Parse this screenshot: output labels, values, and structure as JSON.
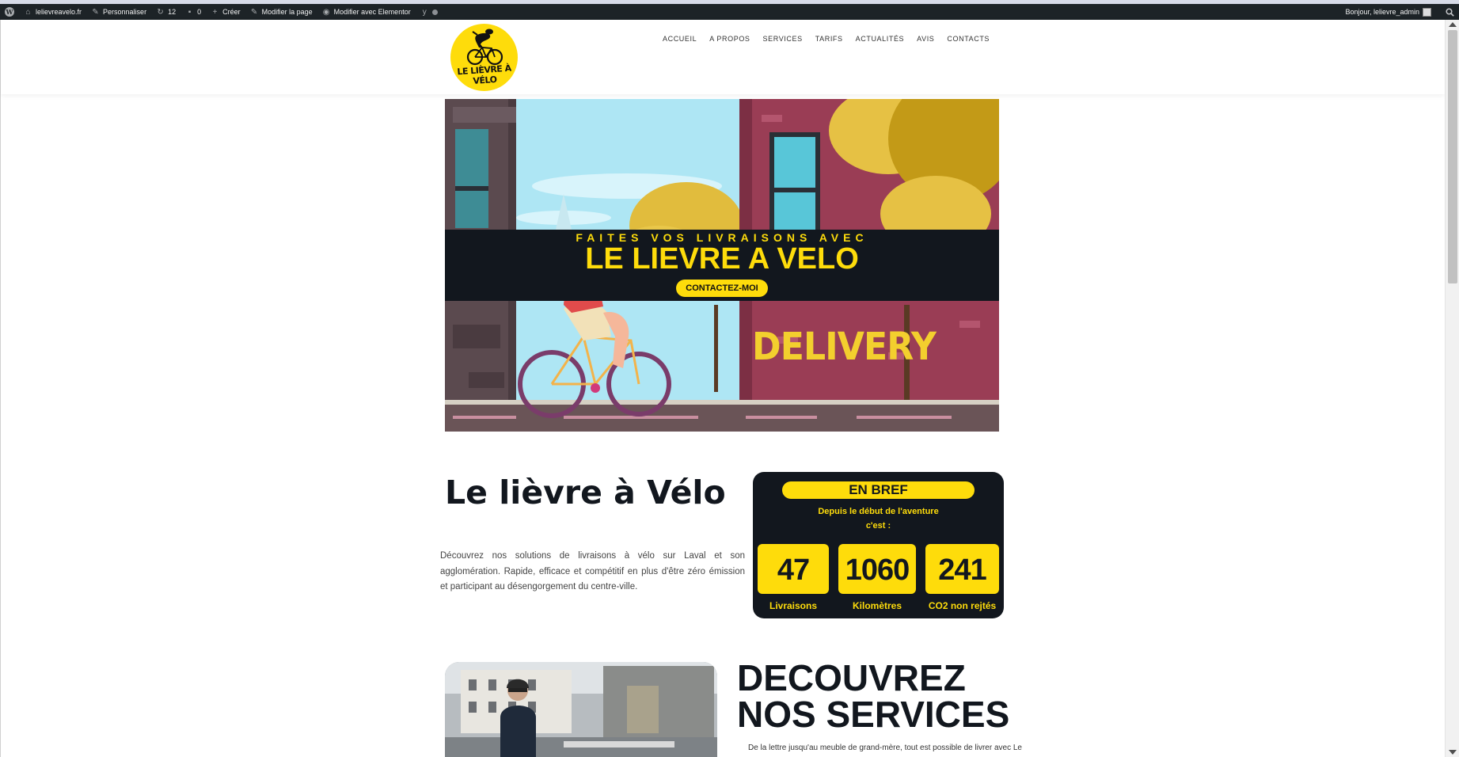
{
  "admin_bar": {
    "site": "lelievreavelo.fr",
    "customize": "Personnaliser",
    "updates_count": "12",
    "comments_count": "0",
    "new": "Créer",
    "edit_page": "Modifier la page",
    "edit_elementor": "Modifier avec Elementor",
    "greeting": "Bonjour, lelievre_admin"
  },
  "header": {
    "logo_text": "LE LIÈVRE À VÉLO",
    "nav": [
      "ACCUEIL",
      "A PROPOS",
      "SERVICES",
      "TARIFS",
      "ACTUALITÉS",
      "AVIS",
      "CONTACTS"
    ]
  },
  "hero": {
    "kicker": "FAITES VOS LIVRAISONS AVEC",
    "title": "LE LIEVRE A VELO",
    "button": "CONTACTEZ-MOI",
    "illustration_text": "DELIVERY"
  },
  "intro": {
    "title": "Le lièvre à Vélo",
    "text": "Découvrez nos solutions de livraisons à vélo sur Laval et son agglomération. Rapide, efficace et compétitif en plus d'être zéro émission et participant au désengorgement du centre-ville."
  },
  "bref": {
    "title": "EN BREF",
    "sub1": "Depuis le début de l'aventure",
    "sub2": "c'est :",
    "stats": [
      {
        "value": "47",
        "label": "Livraisons"
      },
      {
        "value": "1060",
        "label": "Kilomètres"
      },
      {
        "value": "241",
        "label": "CO2 non rejtés"
      }
    ]
  },
  "services": {
    "title_line1": "DECOUVREZ",
    "title_line2": "NOS SERVICES",
    "text": "De la lettre jusqu'au meuble de grand-mère, tout est possible de livrer avec Le"
  },
  "colors": {
    "brand_yellow": "#fedc0b",
    "dark": "#12171e",
    "adminbar": "#1d2327"
  }
}
